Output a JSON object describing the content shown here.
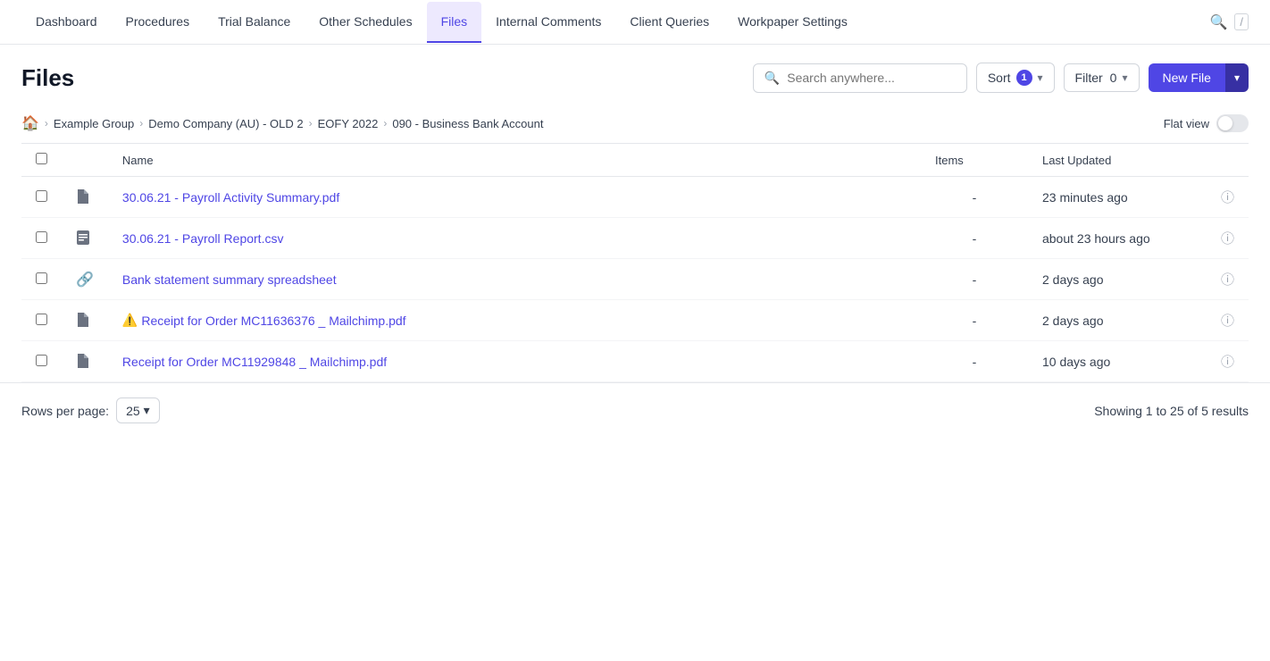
{
  "nav": {
    "items": [
      {
        "id": "dashboard",
        "label": "Dashboard",
        "active": false
      },
      {
        "id": "procedures",
        "label": "Procedures",
        "active": false
      },
      {
        "id": "trial-balance",
        "label": "Trial Balance",
        "active": false
      },
      {
        "id": "other-schedules",
        "label": "Other Schedules",
        "active": false
      },
      {
        "id": "files",
        "label": "Files",
        "active": true
      },
      {
        "id": "internal-comments",
        "label": "Internal Comments",
        "active": false
      },
      {
        "id": "client-queries",
        "label": "Client Queries",
        "active": false
      },
      {
        "id": "workpaper-settings",
        "label": "Workpaper Settings",
        "active": false
      }
    ]
  },
  "search": {
    "placeholder": "Search anywhere..."
  },
  "sort": {
    "label": "Sort",
    "count": "1"
  },
  "filter": {
    "label": "Filter",
    "count": "0"
  },
  "new_file": {
    "label": "New File"
  },
  "page": {
    "title": "Files"
  },
  "breadcrumb": {
    "home_icon": "⌂",
    "items": [
      {
        "id": "example-group",
        "label": "Example Group"
      },
      {
        "id": "demo-company",
        "label": "Demo Company (AU) - OLD 2"
      },
      {
        "id": "eofy",
        "label": "EOFY 2022"
      },
      {
        "id": "account",
        "label": "090 - Business Bank Account"
      }
    ]
  },
  "flat_view": {
    "label": "Flat view"
  },
  "table": {
    "columns": {
      "name": "Name",
      "items": "Items",
      "last_updated": "Last Updated"
    },
    "rows": [
      {
        "id": "row-1",
        "icon_type": "pdf",
        "name": "30.06.21 - Payroll Activity Summary.pdf",
        "items": "-",
        "last_updated": "23 minutes ago",
        "warning": false
      },
      {
        "id": "row-2",
        "icon_type": "csv",
        "name": "30.06.21 - Payroll Report.csv",
        "items": "-",
        "last_updated": "about 23 hours ago",
        "warning": false
      },
      {
        "id": "row-3",
        "icon_type": "link",
        "name": "Bank statement summary spreadsheet",
        "items": "-",
        "last_updated": "2 days ago",
        "warning": false
      },
      {
        "id": "row-4",
        "icon_type": "pdf",
        "name": "Receipt for Order MC11636376 _ Mailchimp.pdf",
        "items": "-",
        "last_updated": "2 days ago",
        "warning": true
      },
      {
        "id": "row-5",
        "icon_type": "pdf",
        "name": "Receipt for Order MC11929848 _ Mailchimp.pdf",
        "items": "-",
        "last_updated": "10 days ago",
        "warning": false
      }
    ]
  },
  "footer": {
    "rows_per_page_label": "Rows per page:",
    "rows_per_page_value": "25",
    "pagination_info": "Showing 1 to 25 of 5 results"
  }
}
